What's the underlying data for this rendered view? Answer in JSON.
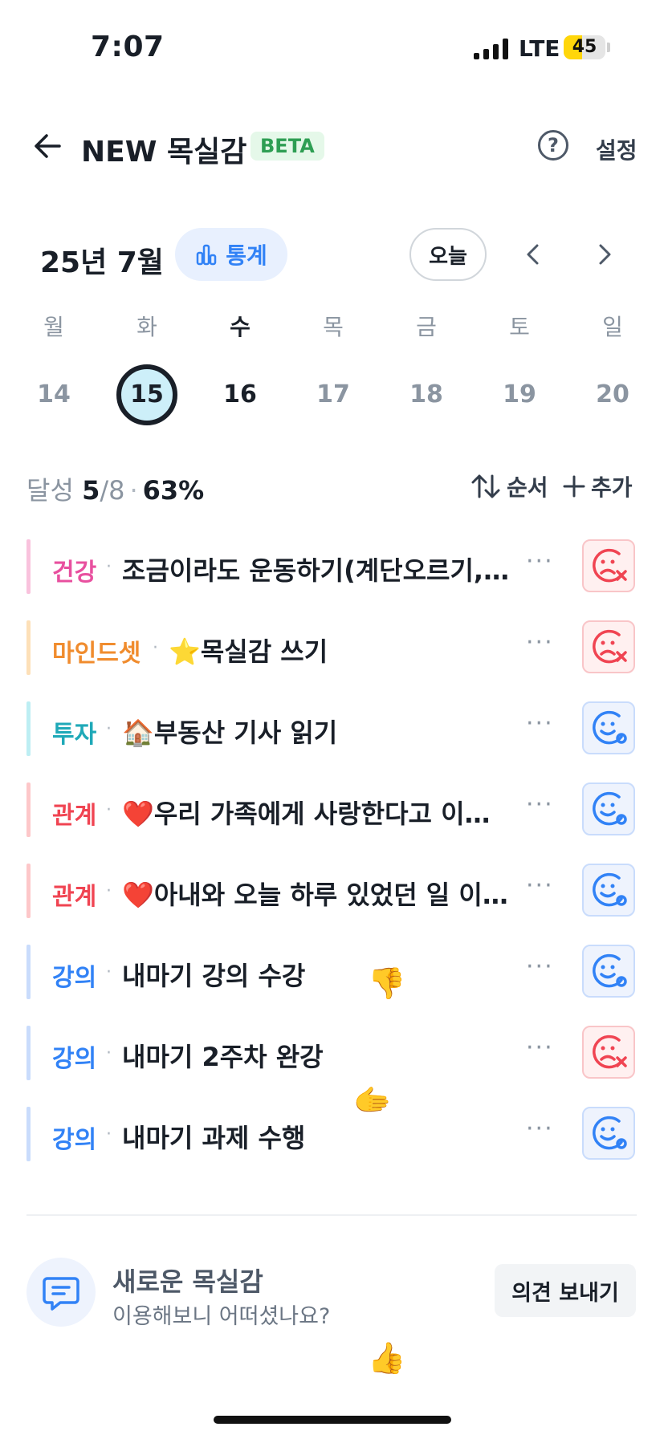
{
  "status_bar": {
    "time": "7:07",
    "network": "LTE",
    "battery": "45",
    "battery_level": 0.45
  },
  "header": {
    "title": "NEW 목실감",
    "badge": "BETA",
    "help_icon": "?",
    "settings": "설정"
  },
  "calendar": {
    "month": "25년 7월",
    "stats_label": "통계",
    "today_label": "오늘",
    "weekdays": [
      "월",
      "화",
      "수",
      "목",
      "금",
      "토",
      "일"
    ],
    "dates": [
      "14",
      "15",
      "16",
      "17",
      "18",
      "19",
      "20"
    ],
    "today_index": 1,
    "selected_index": 2
  },
  "progress": {
    "label": "달성",
    "done": "5",
    "slash_total": "/8",
    "sep": "·",
    "percent": "63%"
  },
  "actions": {
    "order": "순서",
    "add": "추가"
  },
  "habits": [
    {
      "category": "건강",
      "cat_color": "#e8509f",
      "bar_color": "#f9c2dd",
      "name": "조금이라도 운동하기(계단오르기, 스쿼트)",
      "status": "fail"
    },
    {
      "category": "마인드셋",
      "cat_color": "#f08c2e",
      "bar_color": "#fde0b8",
      "name": "⭐목실감 쓰기",
      "status": "fail"
    },
    {
      "category": "투자",
      "cat_color": "#1fa9b8",
      "bar_color": "#bdeef3",
      "name": "🏠부동산 기사 읽기",
      "status": "done"
    },
    {
      "category": "관계",
      "cat_color": "#f04452",
      "bar_color": "#fdc7c9",
      "name": "❤️우리 가족에게 사랑한다고 이야기하기",
      "status": "done"
    },
    {
      "category": "관계",
      "cat_color": "#f04452",
      "bar_color": "#fdc7c9",
      "name": "❤️아내와 오늘 하루 있었던 일 이야기하기",
      "status": "done"
    },
    {
      "category": "강의",
      "cat_color": "#3182f6",
      "bar_color": "#c9dcfc",
      "name": "내마기 강의 수강",
      "status": "done"
    },
    {
      "category": "강의",
      "cat_color": "#3182f6",
      "bar_color": "#c9dcfc",
      "name": "내마기 2주차 완강",
      "status": "fail"
    },
    {
      "category": "강의",
      "cat_color": "#3182f6",
      "bar_color": "#c9dcfc",
      "name": "내마기 과제 수행",
      "status": "done"
    }
  ],
  "feedback": {
    "title": "새로운 목실감",
    "subtitle": "이용해보니 어떠셨나요?",
    "button": "의견 보내기"
  },
  "colors": {
    "accent": "#3182f6",
    "fail": "#f04452",
    "fail_bg": "#fff0f0",
    "done_bg": "#eef3fd"
  },
  "floating": [
    "👎",
    "🫱",
    "👍"
  ]
}
